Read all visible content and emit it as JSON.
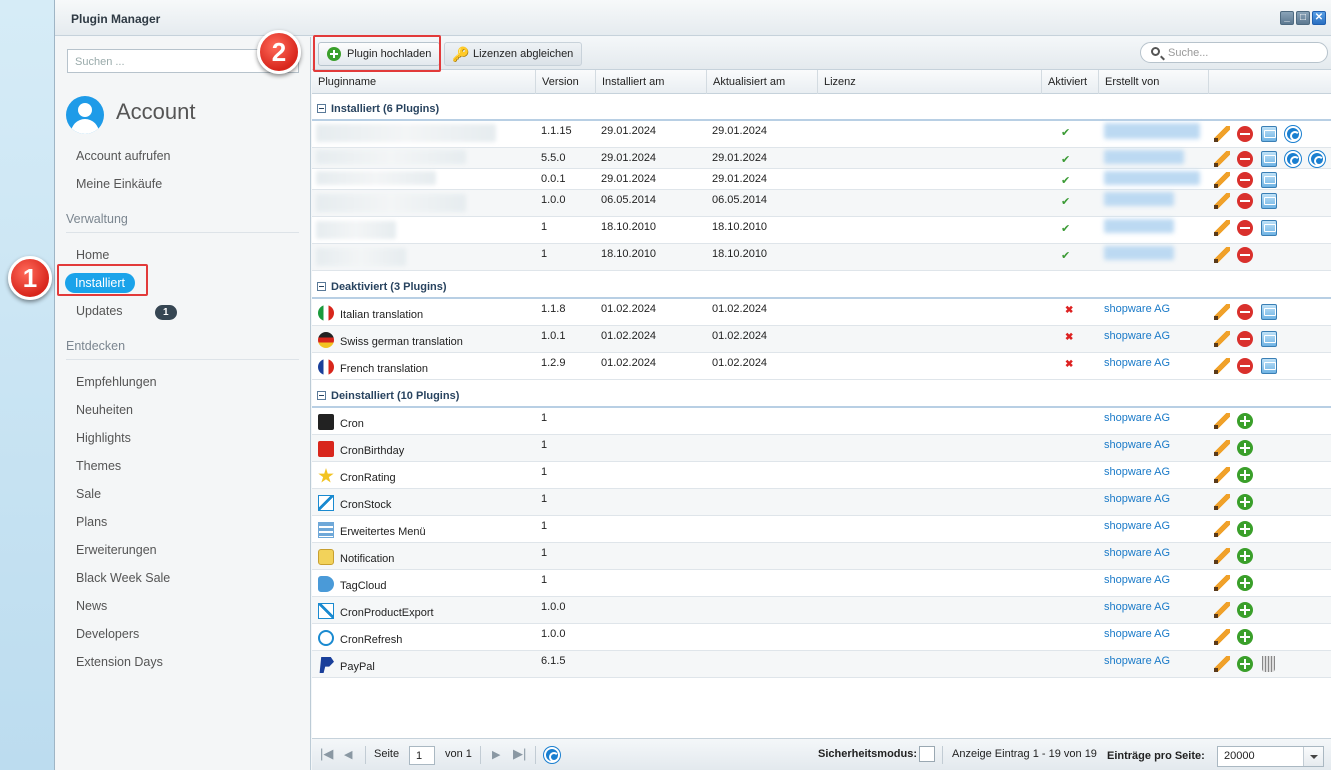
{
  "window": {
    "title": "Plugin Manager"
  },
  "sidebar": {
    "search_placeholder": "Suchen ...",
    "account_label": "Account",
    "account_links": [
      "Account aufrufen",
      "Meine Einkäufe"
    ],
    "sections": {
      "verwaltung": "Verwaltung",
      "entdecken": "Entdecken"
    },
    "verwaltung_items": {
      "home": "Home",
      "installiert": "Installiert",
      "updates": "Updates",
      "updates_badge": "1"
    },
    "entdecken_items": [
      "Empfehlungen",
      "Neuheiten",
      "Highlights",
      "Themes",
      "Sale",
      "Plans",
      "Erweiterungen",
      "Black Week Sale",
      "News",
      "Developers",
      "Extension Days"
    ]
  },
  "markers": {
    "one": "1",
    "two": "2"
  },
  "toolbar": {
    "upload_label": "Plugin hochladen",
    "licenses_label": "Lizenzen abgleichen",
    "search_placeholder": "Suche..."
  },
  "columns": {
    "name": "Pluginname",
    "version": "Version",
    "installed": "Installiert am",
    "updated": "Aktualisiert am",
    "license": "Lizenz",
    "active": "Aktiviert",
    "author": "Erstellt von"
  },
  "groups": {
    "installed": {
      "label": "Installiert (6 Plugins)",
      "rows": [
        {
          "version": "1.1.15",
          "installed": "29.01.2024",
          "updated": "29.01.2024",
          "active": "✔"
        },
        {
          "version": "5.5.0",
          "installed": "29.01.2024",
          "updated": "29.01.2024",
          "active": "✔"
        },
        {
          "version": "0.0.1",
          "installed": "29.01.2024",
          "updated": "29.01.2024",
          "active": "✔"
        },
        {
          "version": "1.0.0",
          "installed": "06.05.2014",
          "updated": "06.05.2014",
          "active": "✔"
        },
        {
          "version": "1",
          "installed": "18.10.2010",
          "updated": "18.10.2010",
          "active": "✔"
        },
        {
          "version": "1",
          "installed": "18.10.2010",
          "updated": "18.10.2010",
          "active": "✔"
        }
      ]
    },
    "deactivated": {
      "label": "Deaktiviert (3 Plugins)",
      "rows": [
        {
          "name": "Italian translation",
          "version": "1.1.8",
          "installed": "01.02.2024",
          "updated": "01.02.2024",
          "active": "✖",
          "author": "shopware AG"
        },
        {
          "name": "Swiss german translation",
          "version": "1.0.1",
          "installed": "01.02.2024",
          "updated": "01.02.2024",
          "active": "✖",
          "author": "shopware AG"
        },
        {
          "name": "French translation",
          "version": "1.2.9",
          "installed": "01.02.2024",
          "updated": "01.02.2024",
          "active": "✖",
          "author": "shopware AG"
        }
      ]
    },
    "uninstalled": {
      "label": "Deinstalliert (10 Plugins)",
      "rows": [
        {
          "name": "Cron",
          "version": "1",
          "author": "shopware AG"
        },
        {
          "name": "CronBirthday",
          "version": "1",
          "author": "shopware AG"
        },
        {
          "name": "CronRating",
          "version": "1",
          "author": "shopware AG"
        },
        {
          "name": "CronStock",
          "version": "1",
          "author": "shopware AG"
        },
        {
          "name": "Erweitertes Menü",
          "version": "1",
          "author": "shopware AG"
        },
        {
          "name": "Notification",
          "version": "1",
          "author": "shopware AG"
        },
        {
          "name": "TagCloud",
          "version": "1",
          "author": "shopware AG"
        },
        {
          "name": "CronProductExport",
          "version": "1.0.0",
          "author": "shopware AG"
        },
        {
          "name": "CronRefresh",
          "version": "1.0.0",
          "author": "shopware AG"
        },
        {
          "name": "PayPal",
          "version": "6.1.5",
          "author": "shopware AG"
        }
      ]
    }
  },
  "paging": {
    "page_label": "Seite",
    "page_value": "1",
    "of_label": "von 1",
    "safe_mode_label": "Sicherheitsmodus:",
    "display_info": "Anzeige Eintrag 1 - 19 von 19",
    "per_page_label": "Einträge pro Seite:",
    "per_page_value": "20000"
  },
  "colors": {
    "accent": "#1aa3ea",
    "highlight": "#e23a3a",
    "link": "#1a7ac8"
  }
}
